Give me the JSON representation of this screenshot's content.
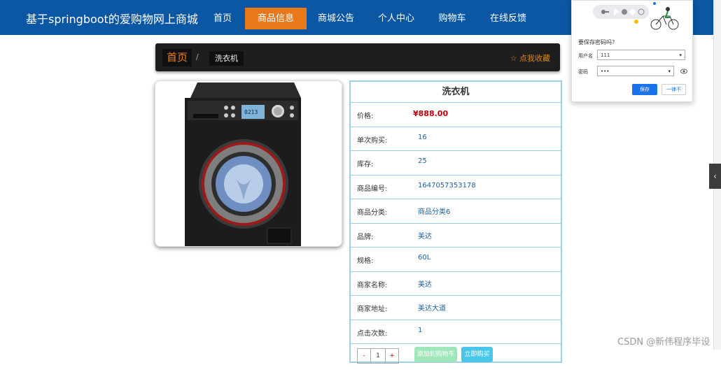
{
  "header": {
    "site_title": "基于springboot的爱购物网上商城",
    "nav": [
      {
        "label": "首页",
        "active": false
      },
      {
        "label": "商品信息",
        "active": true
      },
      {
        "label": "商城公告",
        "active": false
      },
      {
        "label": "个人中心",
        "active": false
      },
      {
        "label": "购物车",
        "active": false
      },
      {
        "label": "在线反馈",
        "active": false
      }
    ]
  },
  "breadcrumb": {
    "home": "首页",
    "separator": "/",
    "current": "洗衣机",
    "favorite": "☆ 点我收藏"
  },
  "product": {
    "title": "洗衣机",
    "price_label": "价格:",
    "price_value": "¥888.00",
    "fields": [
      {
        "label": "单次购买:",
        "value": "16"
      },
      {
        "label": "库存:",
        "value": "25"
      },
      {
        "label": "商品编号:",
        "value": "1647057353178"
      },
      {
        "label": "商品分类:",
        "value": "商品分类6"
      },
      {
        "label": "品牌:",
        "value": "美达"
      },
      {
        "label": "规格:",
        "value": "60L"
      },
      {
        "label": "商家名称:",
        "value": "美达"
      },
      {
        "label": "商家地址:",
        "value": "美达大道"
      },
      {
        "label": "点击次数:",
        "value": "1"
      }
    ],
    "qty_minus": "-",
    "qty_value": "1",
    "qty_plus": "+",
    "add_to_cart": "添加到购物车",
    "buy_now": "立即购买",
    "display_time": "0213"
  },
  "password_popup": {
    "title": "要保存密码吗?",
    "username_label": "用户名",
    "username_value": "111",
    "password_label": "密码",
    "password_value": "•••",
    "save": "保存",
    "never": "一律不"
  },
  "side_tab_glyph": "‹",
  "watermark": "CSDN @新伟程序毕设",
  "colors": {
    "header_bg": "#0b57a4",
    "nav_active": "#e97818",
    "price": "#c0000a",
    "border": "#9fcfe6"
  }
}
